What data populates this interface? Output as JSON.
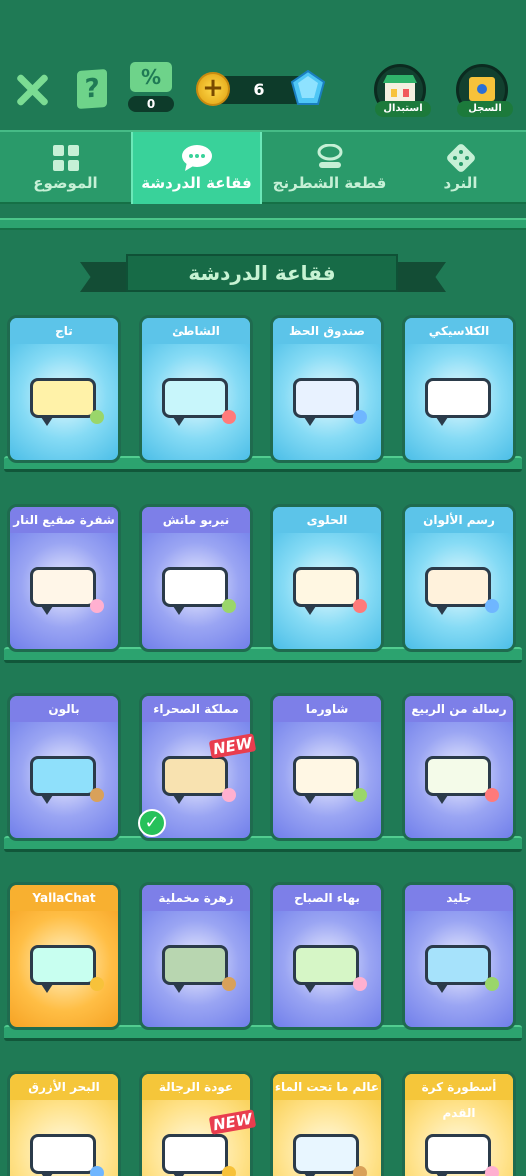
{
  "topbar": {
    "coupon_count": "0",
    "coupon_symbol": "%",
    "coins": "6",
    "shop_label": "استبدال",
    "history_label": "السجل"
  },
  "tabs": [
    {
      "label": "الموضوع",
      "icon": "grid-icon",
      "active": false
    },
    {
      "label": "فقاعة الدردشة",
      "icon": "chat-bubble-icon",
      "active": true
    },
    {
      "label": "قطعة الشطرنج",
      "icon": "chess-piece-icon",
      "active": false
    },
    {
      "label": "النرد",
      "icon": "dice-icon",
      "active": false
    }
  ],
  "section_title": "فقاعة الدردشة",
  "new_badge": "NEW",
  "rows": [
    [
      {
        "name": "الكلاسيكي",
        "bg": "blue",
        "bubble": "#ffffff"
      },
      {
        "name": "صندوق الحظ",
        "bg": "blue",
        "bubble": "#e8f2ff"
      },
      {
        "name": "الشاطئ",
        "bg": "blue",
        "bubble": "#c8f6fb"
      },
      {
        "name": "تاج",
        "bg": "blue",
        "bubble": "#fff2a8"
      }
    ],
    [
      {
        "name": "رسم الألوان",
        "bg": "blue",
        "bubble": "#fff2dc"
      },
      {
        "name": "الحلوى",
        "bg": "blue",
        "bubble": "#fff7e2"
      },
      {
        "name": "نيربو ماتش",
        "bg": "purple",
        "bubble": "#ffffff"
      },
      {
        "name": "شفرة صقيع النار",
        "bg": "purple",
        "bubble": "#fff6e8"
      }
    ],
    [
      {
        "name": "رسالة من الربيع",
        "bg": "purple",
        "bubble": "#f4fbe9"
      },
      {
        "name": "شاورما",
        "bg": "purple",
        "bubble": "#fff7e4"
      },
      {
        "name": "مملكة الصحراء",
        "bg": "purple",
        "bubble": "#f8e2b0"
      },
      {
        "name": "بالون",
        "bg": "purple",
        "bubble": "#8fe0fb"
      }
    ],
    [
      {
        "name": "جليد",
        "bg": "purple",
        "bubble": "#a6e2fb"
      },
      {
        "name": "بهاء الصباح",
        "bg": "purple",
        "bubble": "#d6f6c6"
      },
      {
        "name": "زهرة مخملية",
        "bg": "purple",
        "bubble": "#b8d6b0"
      },
      {
        "name": "YallaChat",
        "bg": "orange",
        "bubble": "#c8fff0"
      }
    ],
    [
      {
        "name": "أسطورة كرة القدم",
        "bg": "yellow",
        "bubble": "#ffffff"
      },
      {
        "name": "عالم ما تحت الماء",
        "bg": "yellow",
        "bubble": "#e8f6ff"
      },
      {
        "name": "عودة الرجالة",
        "bg": "yellow",
        "bubble": "#ffffff"
      },
      {
        "name": "البحر الأزرق",
        "bg": "yellow",
        "bubble": "#ffffff"
      }
    ]
  ]
}
